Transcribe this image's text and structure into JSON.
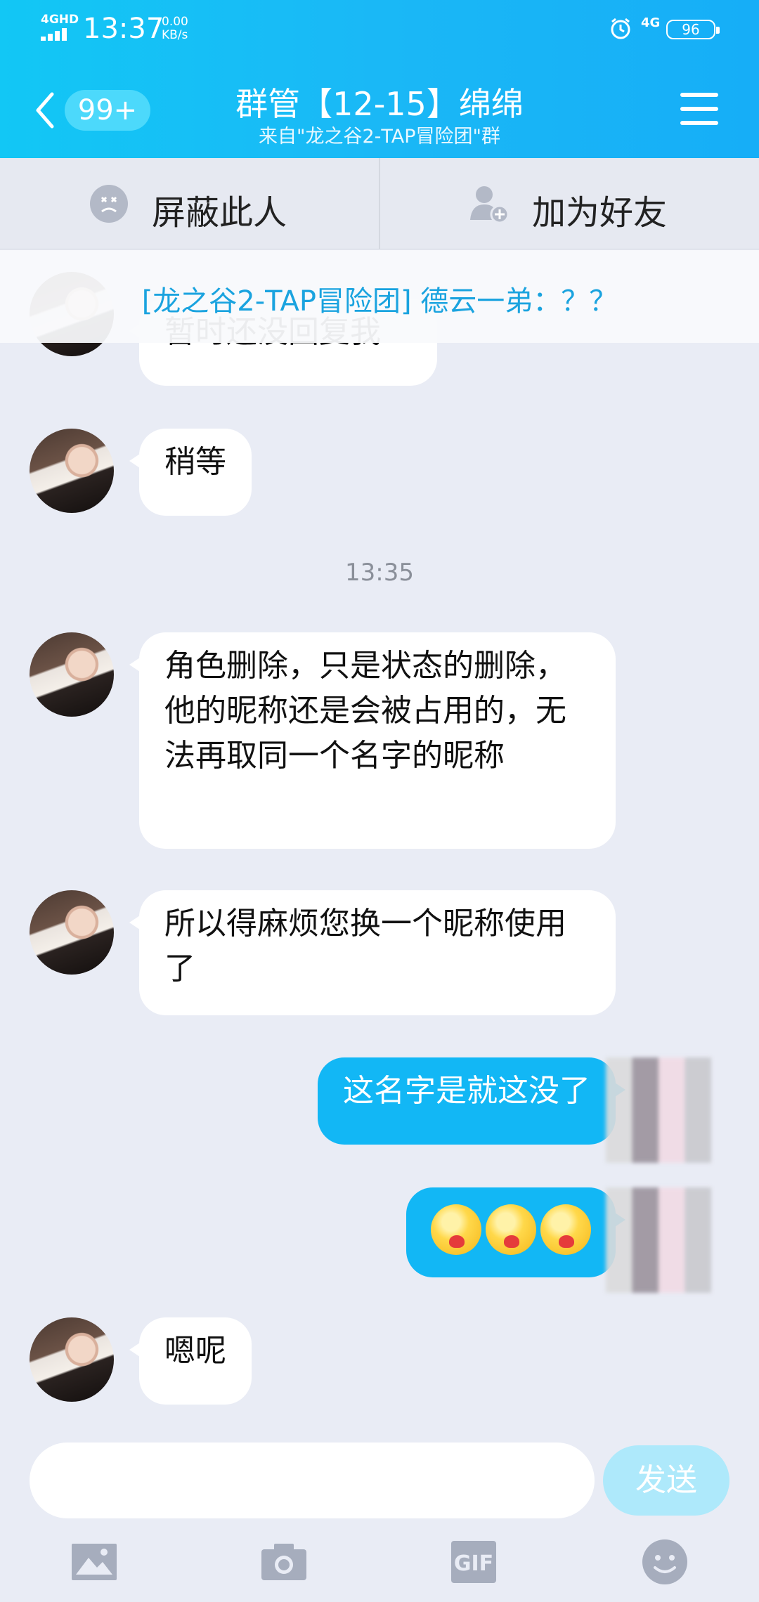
{
  "status_bar": {
    "network": "4GHD",
    "time": "13:37",
    "speed_value": "0.00",
    "speed_unit": "KB/s",
    "network_right": "4G",
    "battery": "96"
  },
  "header": {
    "unread_badge": "99+",
    "title": "群管【12-15】绵绵",
    "subtitle": "来自\"龙之谷2-TAP冒险团\"群"
  },
  "actions": {
    "block_label": "屏蔽此人",
    "add_friend_label": "加为好友"
  },
  "banner": {
    "text": "[龙之谷2-TAP冒险团] 德云一弟：？？"
  },
  "messages": [
    {
      "text": "暂时还没回复我"
    },
    {
      "text": "稍等"
    },
    {
      "timestamp": "13:35"
    },
    {
      "text": "角色删除，只是状态的删除，他的昵称还是会被占用的，无法再取同一个名字的昵称"
    },
    {
      "text": "所以得麻烦您换一个昵称使用了"
    },
    {
      "text": "这名字是就这没了"
    },
    {
      "emoji_count": 3
    },
    {
      "text": "嗯呢"
    }
  ],
  "input": {
    "placeholder": "",
    "send_label": "发送"
  },
  "toolbar": [
    "image-icon",
    "camera-icon",
    "gif-icon",
    "emoji-icon"
  ],
  "colors": {
    "header_start": "#12c7f5",
    "header_end": "#16aef7",
    "outgoing_bubble": "#12b7f5",
    "chat_background": "#e9ecf5",
    "banner_text": "#1aa3df"
  }
}
